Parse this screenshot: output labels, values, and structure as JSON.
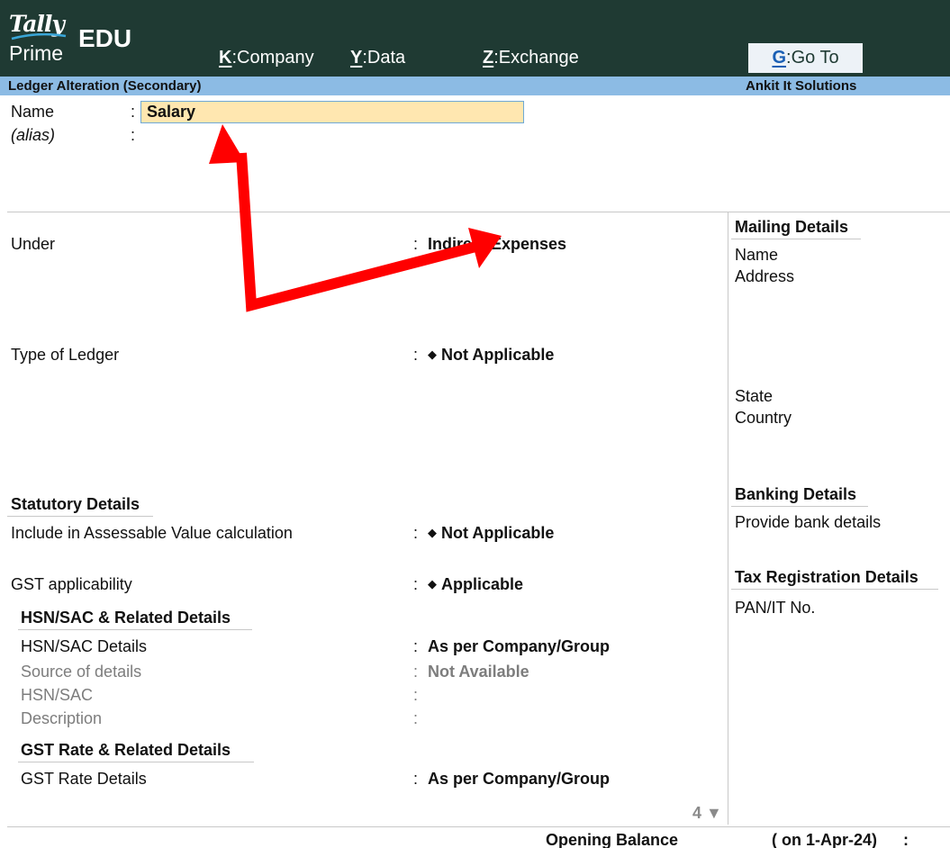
{
  "app": {
    "logo_tally": "Tally",
    "logo_prime": "Prime",
    "edition": "EDU"
  },
  "menu": [
    {
      "key": "K",
      "label": "Company"
    },
    {
      "key": "Y",
      "label": "Data"
    },
    {
      "key": "Z",
      "label": "Exchange"
    }
  ],
  "goto": {
    "key": "G",
    "label": "Go To"
  },
  "titlebar": {
    "screen_title": "Ledger Alteration (Secondary)",
    "company": "Ankit It Solutions"
  },
  "ledger": {
    "name_label": "Name",
    "name_value": "Salary",
    "alias_label": "(alias)",
    "under_label": "Under",
    "under_value": "Indirect Expenses",
    "type_label": "Type of Ledger",
    "type_value": "Not Applicable"
  },
  "statutory": {
    "heading": "Statutory Details",
    "assessable_label": "Include in Assessable Value calculation",
    "assessable_value": "Not Applicable",
    "gst_label": "GST applicability",
    "gst_value": "Applicable",
    "hsn_heading": "HSN/SAC & Related Details",
    "hsn_details_label": "HSN/SAC Details",
    "hsn_details_value": "As per Company/Group",
    "source_label": "Source of details",
    "source_value": "Not Available",
    "hsn_label": "HSN/SAC",
    "description_label": "Description",
    "rate_heading": "GST Rate & Related Details",
    "rate_details_label": "GST Rate Details",
    "rate_details_value": "As per Company/Group"
  },
  "right_panel": {
    "mailing_heading": "Mailing Details",
    "name_label": "Name",
    "address_label": "Address",
    "state_label": "State",
    "country_label": "Country",
    "banking_heading": "Banking Details",
    "bank_label": "Provide bank details",
    "tax_heading": "Tax Registration Details",
    "pan_label": "PAN/IT No."
  },
  "scroll": {
    "page": "4",
    "symbol": "▼"
  },
  "footer": {
    "opening_label": "Opening Balance",
    "opening_date": "( on 1-Apr-24)",
    "opening_colon": ":"
  },
  "colors": {
    "topbar": "#1f3a33",
    "titlebar": "#8cbbe4",
    "input_bg": "#ffe7b0",
    "annotation_arrow": "#ff0000"
  }
}
